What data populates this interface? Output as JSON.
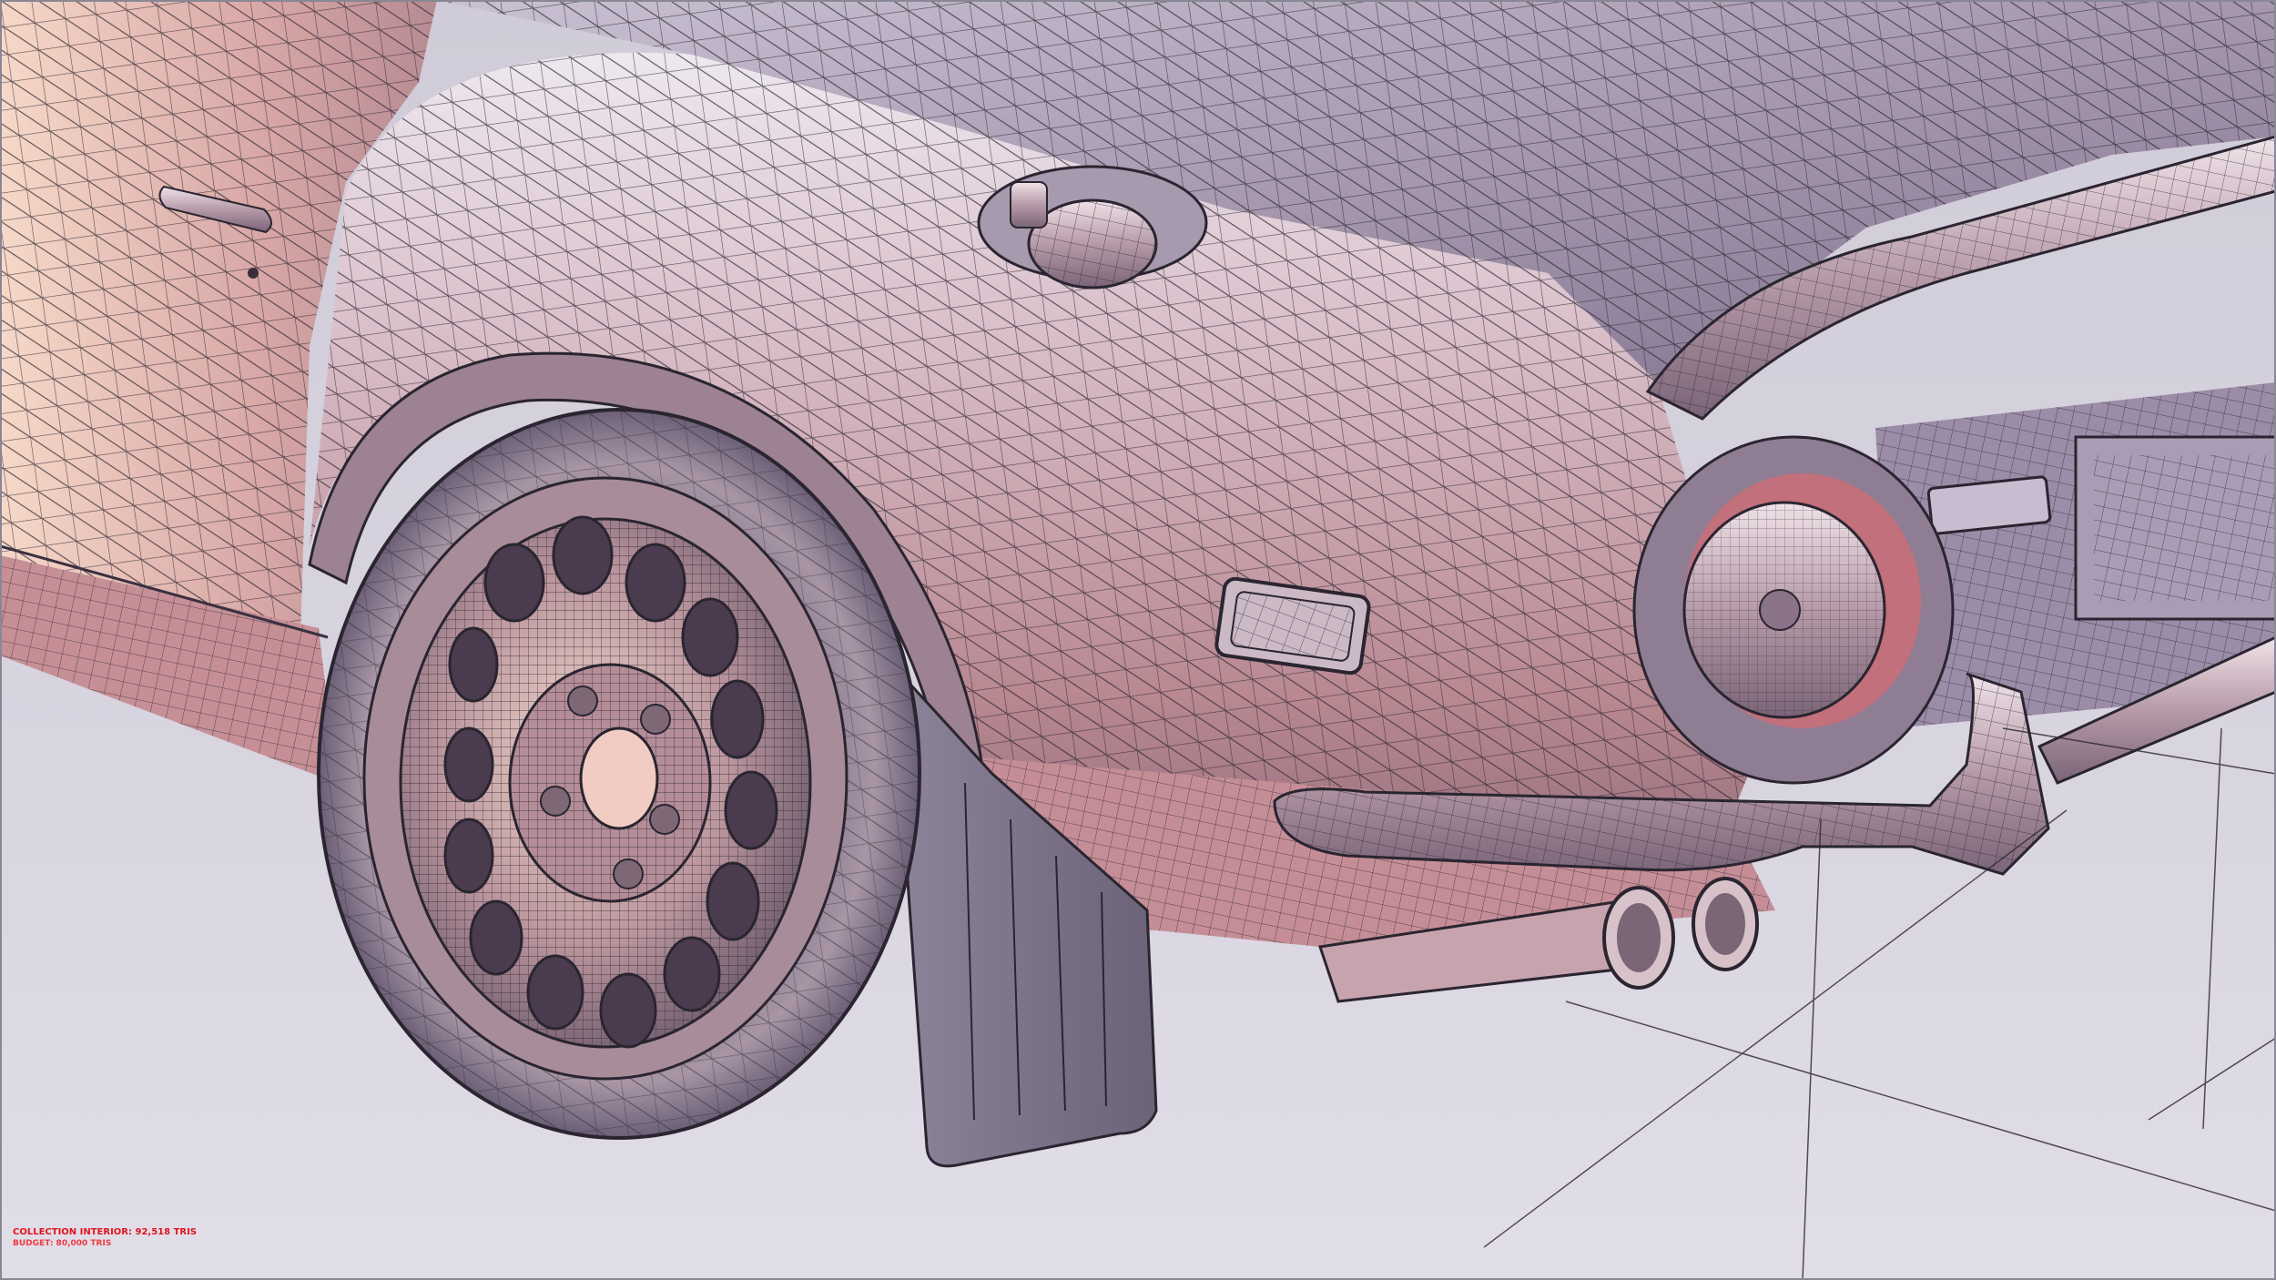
{
  "viewport": {
    "stats": {
      "collection": "COLLECTION INTERIOR: 92,518 TRIS",
      "budget": "BUDGET: 80,000 TRIS"
    }
  },
  "colors": {
    "background": "#d6d2de",
    "stats_text": "#e0141c",
    "wire": "#2a2530",
    "body_light": "#f3dcd2",
    "body_mid": "#c7a0a6",
    "body_dark": "#8f6c7b"
  }
}
